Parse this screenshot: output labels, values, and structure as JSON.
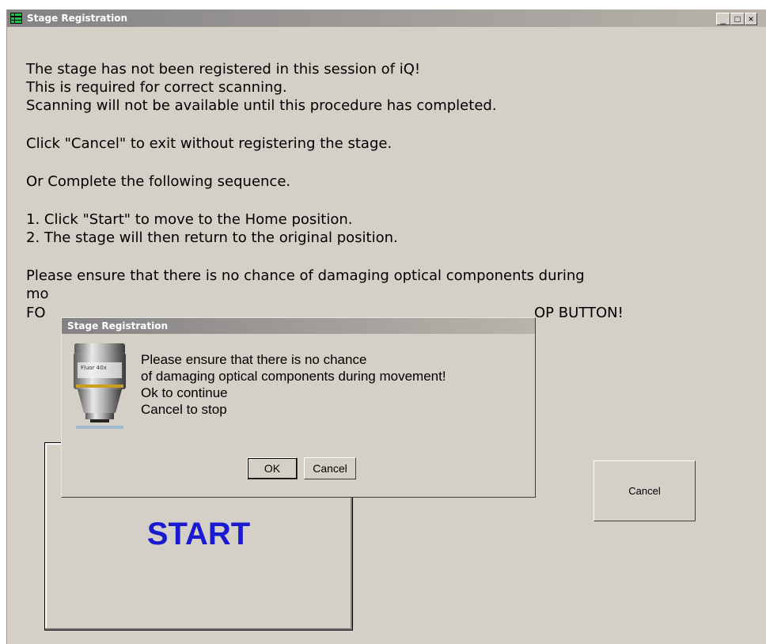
{
  "window": {
    "title": "Stage Registration",
    "controls": {
      "minimize": "_",
      "maximize": "□",
      "close": "×"
    }
  },
  "instructions": {
    "line1": "The stage has not been registered in this session of iQ!",
    "line2": "This is required for correct scanning.",
    "line3": "Scanning will not be available until this procedure has completed.",
    "line4": "Click \"Cancel\" to exit without registering the stage.",
    "line5": "Or Complete the following sequence.",
    "line6": "1. Click \"Start\" to move to the Home position.",
    "line7": "2. The stage will then return to the original position.",
    "line8": "Please ensure that there is no chance of damaging optical components during",
    "line9_visible": "mo",
    "line10_visible_left": "FO",
    "line10_visible_right": "OP BUTTON!"
  },
  "buttons": {
    "start": "START",
    "cancel": "Cancel"
  },
  "dialog": {
    "title": "Stage Registration",
    "icon": "objective-lens-icon",
    "lens_label": "Fluor 40x",
    "messages": [
      "Please ensure that there is no chance",
      "of damaging optical components during movement!",
      "Ok to continue",
      "Cancel to stop"
    ],
    "ok": "OK",
    "cancel": "Cancel"
  },
  "colors": {
    "window_bg": "#d4d0c8",
    "titlebar": "#848284",
    "start_text": "#1a1ad0"
  }
}
